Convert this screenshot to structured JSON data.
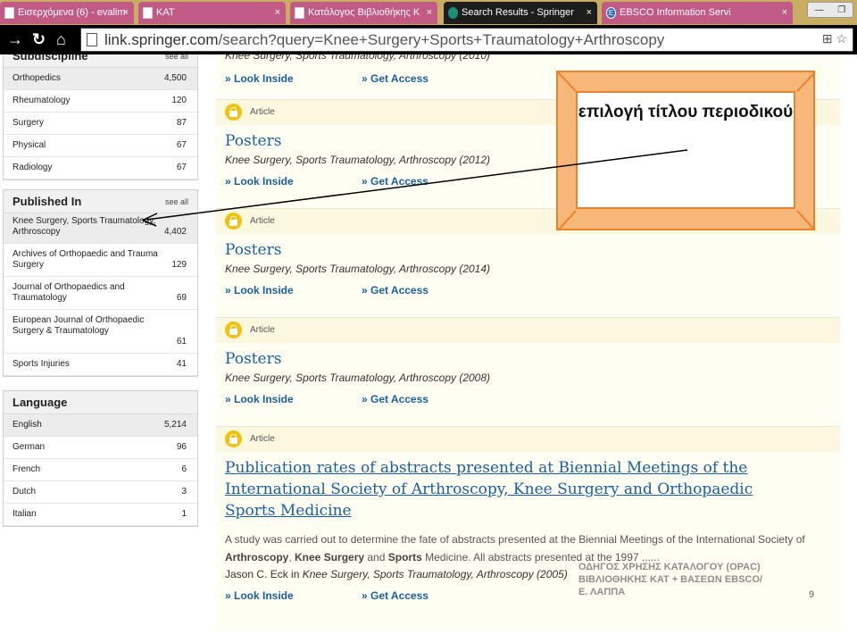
{
  "browser": {
    "tabs": [
      {
        "label": "Εισερχόμενα (6) - evalim",
        "icon": "mail-icon"
      },
      {
        "label": "KAT",
        "icon": "page-icon"
      },
      {
        "label": "Κατάλογος Βιβλιοθήκης Κ",
        "icon": "page-icon"
      },
      {
        "label": "Search Results - Springer",
        "icon": "springer-icon"
      },
      {
        "label": "EBSCO Information Servi",
        "icon": "ebsco-icon"
      }
    ],
    "tab_close": "×",
    "url_host": "link.springer.com",
    "url_path": "/search?query=Knee+Surgery+Sports+Traumatology+Arthroscopy"
  },
  "sidebar": {
    "see_all": "see all",
    "subdiscipline": {
      "title": "Subdiscipline",
      "items": [
        {
          "label": "Orthopedics",
          "count": "4,500"
        },
        {
          "label": "Rheumatology",
          "count": "120"
        },
        {
          "label": "Surgery",
          "count": "87"
        },
        {
          "label": "Physical",
          "count": "67"
        },
        {
          "label": "Radiology",
          "count": "67"
        }
      ]
    },
    "published_in": {
      "title": "Published In",
      "items": [
        {
          "label": "Knee Surgery, Sports Traumatology, Arthroscopy",
          "count": "4,402"
        },
        {
          "label": "Archives of Orthopaedic and Trauma Surgery",
          "count": "129"
        },
        {
          "label": "Journal of Orthopaedics and Traumatology",
          "count": "69"
        },
        {
          "label": "European Journal of Orthopaedic Surgery & Traumatology",
          "count": "61"
        },
        {
          "label": "Sports Injuries",
          "count": "41"
        }
      ]
    },
    "language": {
      "title": "Language",
      "items": [
        {
          "label": "English",
          "count": "5,214"
        },
        {
          "label": "German",
          "count": "96"
        },
        {
          "label": "French",
          "count": "6"
        },
        {
          "label": "Dutch",
          "count": "3"
        },
        {
          "label": "Italian",
          "count": "1"
        }
      ]
    }
  },
  "results": {
    "look_inside": "» Look Inside",
    "get_access": "» Get Access",
    "top_meta": "Knee Surgery, Sports Traumatology, Arthroscopy (2010)",
    "items": [
      {
        "type": "Article",
        "title": "Posters",
        "meta": "Knee Surgery, Sports Traumatology, Arthroscopy (2012)"
      },
      {
        "type": "Article",
        "title": "Posters",
        "meta": "Knee Surgery, Sports Traumatology, Arthroscopy (2014)"
      },
      {
        "type": "Article",
        "title": "Posters",
        "meta": "Knee Surgery, Sports Traumatology, Arthroscopy (2008)"
      }
    ],
    "featured": {
      "type": "Article",
      "title": "Publication rates of abstracts presented at Biennial Meetings of the International Society of Arthroscopy, Knee Surgery and Orthopaedic Sports Medicine",
      "snippet_1": "A study was carried out to determine the fate of abstracts presented at the Biennial Meetings of the International Society of ",
      "hl_1": "Arthroscopy",
      "sep_1": ", ",
      "hl_2": "Knee Surgery",
      "snippet_2": " and ",
      "hl_3": "Sports",
      "snippet_3": " Medicine. All abstracts presented at the 1997 ......",
      "author": "Jason C. Eck",
      "author_in": " in ",
      "meta": "Knee Surgery, Sports Traumatology, Arthroscopy (2005)"
    }
  },
  "annotation": {
    "callout_text": "επιλογή τίτλου περιοδικού",
    "footer": "ΟΔΗΓΟΣ ΧΡΗΣΗΣ ΚΑΤΑΛΟΓΟΥ (OPAC) ΒΙΒΛΙΟΘΗΚΗΣ ΚΑΤ + ΒΑΣΕΩΝ EBSCO/ Ε. ΛΑΠΠΑ",
    "page_number": "9"
  },
  "colors": {
    "tab_bg": "#c25a86",
    "tab_active": "#1d1d1d",
    "link": "#1a5e9e",
    "callout_fill": "#f7b779",
    "callout_border": "#e8822b",
    "lock": "#f0c20c"
  }
}
